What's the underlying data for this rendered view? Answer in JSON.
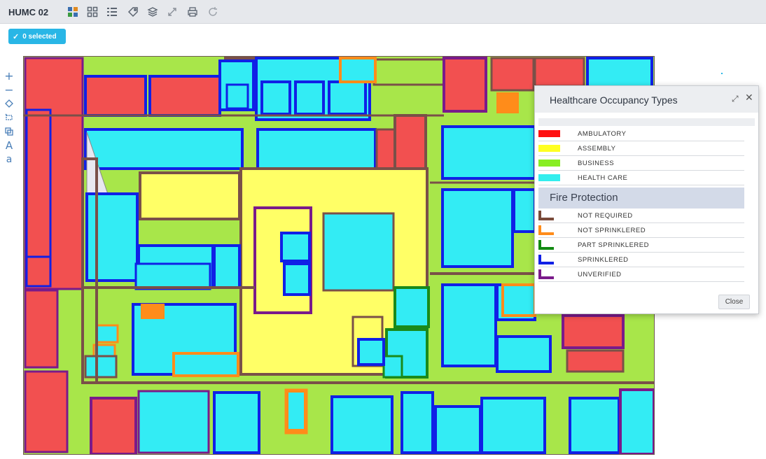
{
  "app": {
    "title": "HUMC 02"
  },
  "toolbar": {
    "icons": [
      "floorplan-color-icon",
      "grid-icon",
      "list-icon",
      "tag-icon",
      "layers-icon",
      "expand-icon",
      "print-icon",
      "refresh-icon"
    ]
  },
  "selection": {
    "label": "0 selected"
  },
  "tools": {
    "zoom_in": "+",
    "zoom_out": "−",
    "text_large": "A",
    "text_small": "a"
  },
  "legend": {
    "title": "Healthcare Occupancy Types",
    "occupancy": [
      {
        "label": "AMBULATORY",
        "color": "#ff1010"
      },
      {
        "label": "ASSEMBLY",
        "color": "#ffff22"
      },
      {
        "label": "BUSINESS",
        "color": "#88ee22"
      },
      {
        "label": "HEALTH CARE",
        "color": "#33eeee"
      }
    ],
    "fire_title": "Fire Protection",
    "fire": [
      {
        "label": "NOT REQUIRED",
        "color": "#7a4a3a"
      },
      {
        "label": "NOT SPRINKLERED",
        "color": "#ff8c1a"
      },
      {
        "label": "PART SPRINKLERED",
        "color": "#128a12"
      },
      {
        "label": "SPRINKLERED",
        "color": "#1020e6"
      },
      {
        "label": "UNVERIFIED",
        "color": "#7a1a8a"
      }
    ],
    "close_label": "Close"
  },
  "colors": {
    "ambulatory": "#f25050",
    "assembly": "#ffff66",
    "business": "#a8e64a",
    "health_care": "#33ecf4",
    "not_required": "#7a5048",
    "not_sprinklered": "#ff8c1a",
    "part_sprinklered": "#1a8a1a",
    "sprinklered": "#1020e6",
    "unverified": "#7a1a8a",
    "accent": "#29b6e6"
  }
}
